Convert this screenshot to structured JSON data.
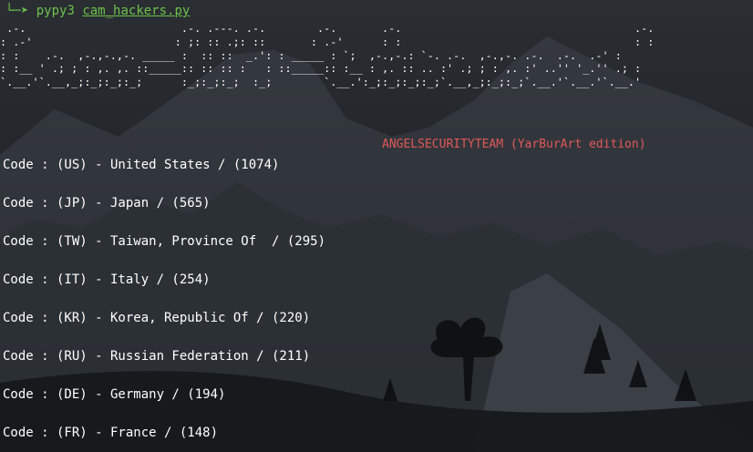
{
  "prompt": {
    "arrow": "└─➤",
    "command": "pypy3",
    "filename": "cam_hackers.py"
  },
  "banner": {
    "ascii_art": [
      " .-.                        .-. .---. .-.        .-.       .-.                                    .-.",
      ": .-'                      : ;: :: .;: ::       : .-'      : :                                    : :",
      ": :    .-.  ,-.,-.,-. _____ :  :: ::  _.': : _____ : `;  ,-.,-.: `-. .-.  ,-.,-. .-.  .-.  .-' :",
      ": :__ ' .; ; : ,. ,. ::_____:: :: :: :   : ::_____:: :__ : ,. :: .. :' .; ; : ,. :' ..'' '_.'' .; :",
      "`.__.'`.__,_;:_;:_;:_;      :_;:_;:_;  :_;        `.__.':_;:_;:_;:_;`.__,_;:_;:_;`.__.'`.__.'`.__.'"
    ],
    "credit": "ANGELSECURITYTEAM (YarBurArt edition)"
  },
  "results": [
    {
      "text": "Code : (US) - United States / (1074)"
    },
    {
      "text": "Code : (JP) - Japan / (565)"
    },
    {
      "text": "Code : (TW) - Taiwan, Province Of  / (295)"
    },
    {
      "text": "Code : (IT) - Italy / (254)"
    },
    {
      "text": "Code : (KR) - Korea, Republic Of / (220)"
    },
    {
      "text": "Code : (RU) - Russian Federation / (211)"
    },
    {
      "text": "Code : (DE) - Germany / (194)"
    },
    {
      "text": "Code : (FR) - France / (148)"
    }
  ],
  "colors": {
    "background": "#1c1f23",
    "prompt": "#6ec04b",
    "text": "#ffffff",
    "credit": "#e05858"
  }
}
